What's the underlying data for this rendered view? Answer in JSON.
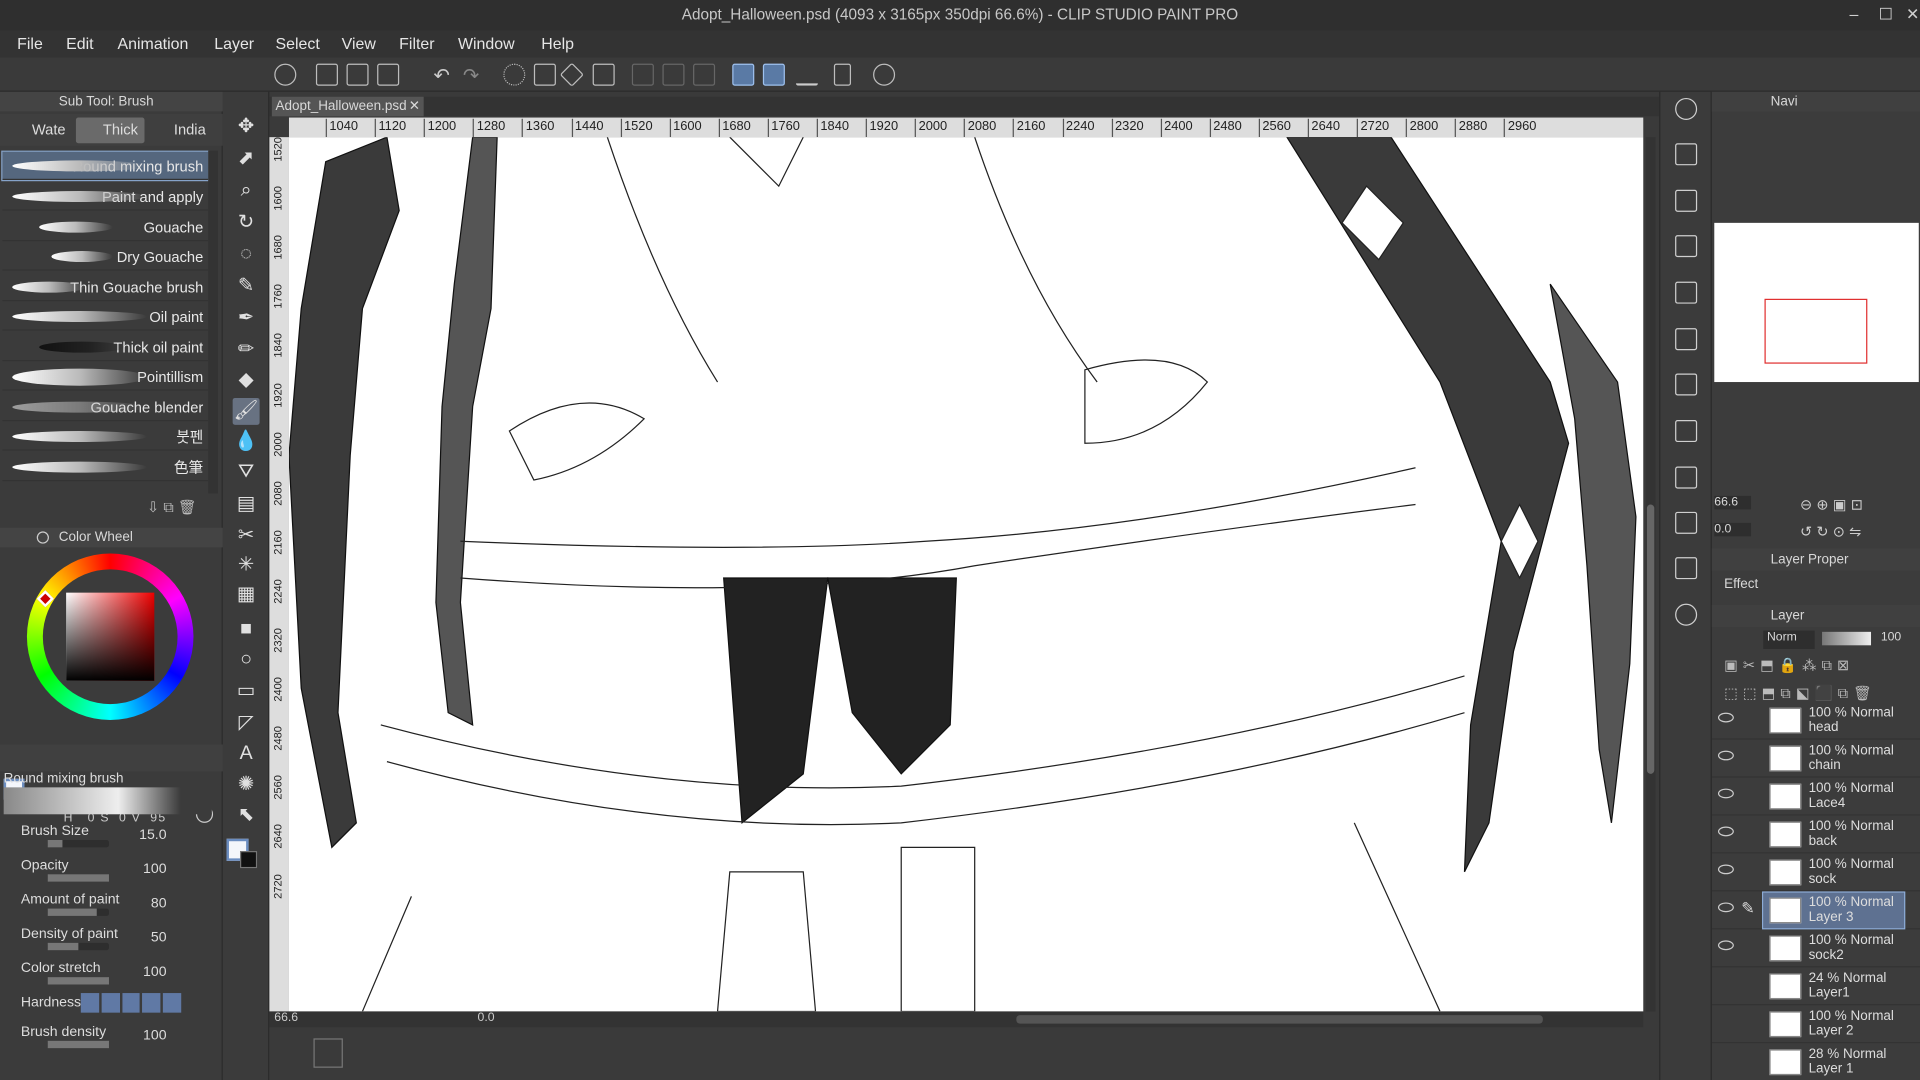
{
  "title": "Adopt_Halloween.psd (4093 x 3165px 350dpi 66.6%) - CLIP STUDIO PAINT PRO",
  "menu": [
    "File",
    "Edit",
    "Animation",
    "Layer",
    "Select",
    "View",
    "Filter",
    "Window",
    "Help"
  ],
  "subtool": {
    "header": "Sub Tool: Brush",
    "tabs": [
      "Wate",
      "Thick",
      "India"
    ],
    "brushes": [
      "Round mixing brush",
      "Paint and apply",
      "Gouache",
      "Dry Gouache",
      "Thin Gouache brush",
      "Oil paint",
      "Thick oil paint",
      "Pointillism",
      "Gouache blender",
      "붓펜",
      "色筆"
    ],
    "selected": 0
  },
  "color": {
    "header": "Color Wheel",
    "values": [
      "H",
      "0",
      "S",
      "0",
      "V",
      "95"
    ]
  },
  "toolprop": {
    "name": "Round mixing brush",
    "props": [
      {
        "label": "Brush Size",
        "value": "15.0"
      },
      {
        "label": "Opacity",
        "value": "100"
      },
      {
        "label": "Amount of paint",
        "value": "80"
      },
      {
        "label": "Density of paint",
        "value": "50"
      },
      {
        "label": "Color stretch",
        "value": "100"
      },
      {
        "label": "Hardness",
        "value": ""
      },
      {
        "label": "Brush density",
        "value": "100"
      }
    ]
  },
  "doc": {
    "tab": "Adopt_Halloween.psd",
    "ruler_h": [
      "1040",
      "1120",
      "1200",
      "1280",
      "1360",
      "1440",
      "1520",
      "1600",
      "1680",
      "1760",
      "1840",
      "1920",
      "2000",
      "2080",
      "2160",
      "2240",
      "2320",
      "2400",
      "2480",
      "2560",
      "2640",
      "2720",
      "2800",
      "2880",
      "2960"
    ],
    "ruler_v": [
      "1520",
      "1600",
      "1680",
      "1760",
      "1840",
      "1920",
      "2000",
      "2080",
      "2160",
      "2240",
      "2320",
      "2400",
      "2480",
      "2560",
      "2640",
      "2720"
    ],
    "zoom": "66.6",
    "angle": "0.0"
  },
  "nav": {
    "tab": "Navi",
    "zoom": "66.6",
    "angle": "0.0"
  },
  "layerprop": {
    "tab": "Layer Proper",
    "effect": "Effect"
  },
  "layers_panel": {
    "tab": "Layer",
    "blend": "Norm",
    "opacity": "100"
  },
  "layers": [
    {
      "top": "100 % Normal",
      "name": "head"
    },
    {
      "top": "100 % Normal",
      "name": "chain"
    },
    {
      "top": "100 % Normal",
      "name": "Lace4"
    },
    {
      "top": "100 % Normal",
      "name": "back"
    },
    {
      "top": "100 % Normal",
      "name": "sock"
    },
    {
      "top": "100 % Normal",
      "name": "Layer 3"
    },
    {
      "top": "100 % Normal",
      "name": "sock2"
    },
    {
      "top": "24 % Normal",
      "name": "Layer1"
    },
    {
      "top": "100 % Normal",
      "name": "Layer 2"
    },
    {
      "top": "28 % Normal",
      "name": "Layer 1"
    }
  ],
  "selected_layer": 5
}
